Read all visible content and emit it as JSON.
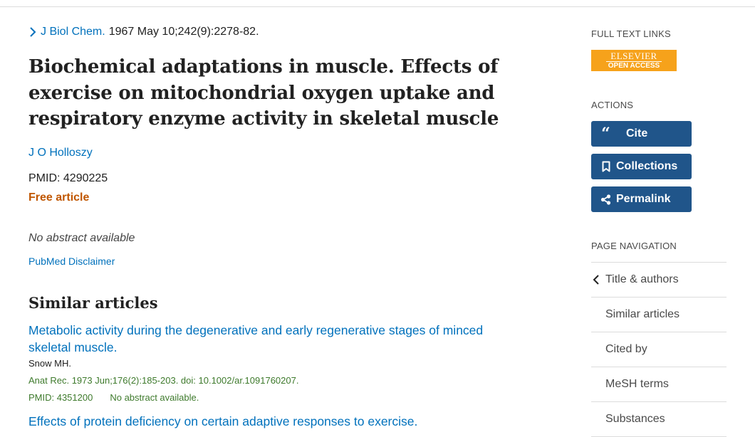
{
  "article": {
    "journal": "J Biol Chem.",
    "citation": "1967 May 10;242(9):2278-82.",
    "title": "Biochemical adaptations in muscle. Effects of exercise on mitochondrial oxygen uptake and respiratory enzyme activity in skeletal muscle",
    "authors": "J O Holloszy",
    "pmid_label": "PMID: 4290225",
    "free_label": "Free article",
    "no_abstract": "No abstract available",
    "disclaimer": "PubMed Disclaimer"
  },
  "similar": {
    "heading": "Similar articles",
    "items": [
      {
        "title": "Metabolic activity during the degenerative and early regenerative stages of minced skeletal muscle.",
        "authors": "Snow MH.",
        "citation": "Anat Rec. 1973 Jun;176(2):185-203. doi: 10.1002/ar.1091760207.",
        "pmid": "PMID: 4351200",
        "note": "No abstract available."
      },
      {
        "title": "Effects of protein deficiency on certain adaptive responses to exercise."
      }
    ]
  },
  "sidebar": {
    "full_text_heading": "FULL TEXT LINKS",
    "elsevier_top": "ELSEVIER",
    "elsevier_bottom": "OPEN ACCESS",
    "actions_heading": "ACTIONS",
    "actions": {
      "cite": "Cite",
      "collections": "Collections",
      "permalink": "Permalink"
    },
    "page_nav_heading": "PAGE NAVIGATION",
    "page_nav": [
      "Title & authors",
      "Similar articles",
      "Cited by",
      "MeSH terms",
      "Substances"
    ]
  },
  "colors": {
    "link": "#0071bc",
    "button": "#20558a",
    "free": "#c05600",
    "citation_green": "#3e7a2c",
    "elsevier": "#f6a21b"
  },
  "icons": [
    "chevron-right-icon",
    "quote-icon",
    "bookmark-icon",
    "share-icon",
    "chevron-left-icon"
  ]
}
